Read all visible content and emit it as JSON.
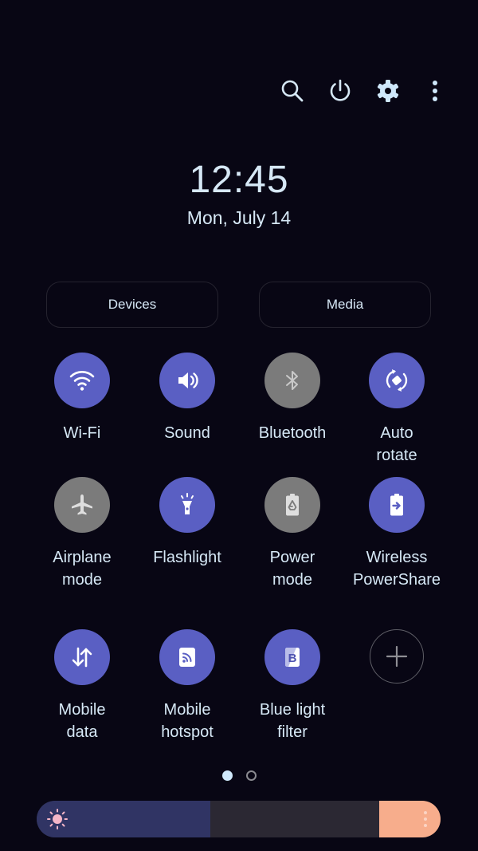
{
  "top_icons": [
    {
      "name": "search-icon",
      "label": "Search"
    },
    {
      "name": "power-icon",
      "label": "Power"
    },
    {
      "name": "gear-icon",
      "label": "Settings"
    },
    {
      "name": "more-vertical-icon",
      "label": "More options"
    }
  ],
  "clock": {
    "time": "12:45",
    "date": "Mon, July 14"
  },
  "pills": {
    "devices": "Devices",
    "media": "Media"
  },
  "tiles": [
    {
      "id": "wifi",
      "label": "Wi-Fi",
      "icon": "wifi-icon",
      "state": "on"
    },
    {
      "id": "sound",
      "label": "Sound",
      "icon": "speaker-icon",
      "state": "on"
    },
    {
      "id": "bluetooth",
      "label": "Bluetooth",
      "icon": "bluetooth-icon",
      "state": "off"
    },
    {
      "id": "auto-rotate",
      "label": "Auto\nrotate",
      "icon": "rotate-icon",
      "state": "on"
    },
    {
      "id": "airplane",
      "label": "Airplane\nmode",
      "icon": "airplane-icon",
      "state": "off"
    },
    {
      "id": "flashlight",
      "label": "Flashlight",
      "icon": "flashlight-icon",
      "state": "on"
    },
    {
      "id": "power-mode",
      "label": "Power\nmode",
      "icon": "battery-recycle-icon",
      "state": "off"
    },
    {
      "id": "wireless-powershare",
      "label": "Wireless\nPowerShare",
      "icon": "battery-share-icon",
      "state": "on"
    },
    {
      "id": "mobile-data",
      "label": "Mobile\ndata",
      "icon": "data-arrows-icon",
      "state": "on"
    },
    {
      "id": "mobile-hotspot",
      "label": "Mobile\nhotspot",
      "icon": "hotspot-icon",
      "state": "on"
    },
    {
      "id": "blue-light",
      "label": "Blue light\nfilter",
      "icon": "blue-light-icon",
      "state": "on"
    },
    {
      "id": "add",
      "label": "",
      "icon": "plus-icon",
      "state": "add"
    }
  ],
  "pager": {
    "pages": 2,
    "current": 1
  },
  "brightness": {
    "level_percent": 43
  },
  "colors": {
    "background": "#080614",
    "tile_on": "#5a5fc3",
    "tile_off": "#7b7b7b",
    "text": "#d6e8f6",
    "slider_fill": "#303464",
    "slider_track": "#2b2833",
    "slider_more": "#f7ad8c",
    "sun": "#f5b6c8"
  }
}
